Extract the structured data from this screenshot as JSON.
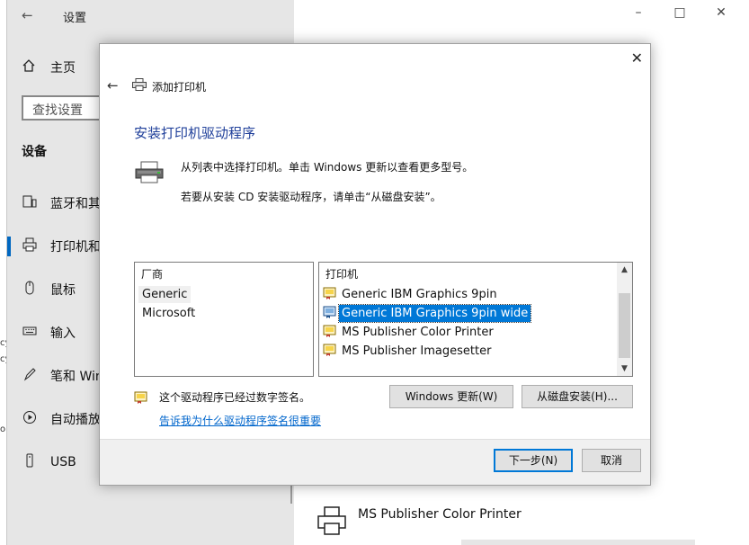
{
  "settings": {
    "title": "设置",
    "home_label": "主页",
    "search_placeholder": "查找设置",
    "section_title": "设备",
    "nav_items": [
      {
        "label": "蓝牙和其"
      },
      {
        "label": "打印机和"
      },
      {
        "label": "鼠标"
      },
      {
        "label": "输入"
      },
      {
        "label": "笔和 Win"
      },
      {
        "label": "自动播放"
      },
      {
        "label": "USB"
      }
    ],
    "strip_fragments": [
      "cy",
      "cy",
      "ol"
    ],
    "bg_printer_label": "MS Publisher Color Printer"
  },
  "dialog": {
    "title": "添加打印机",
    "heading": "安装打印机驱动程序",
    "message1": "从列表中选择打印机。单击 Windows 更新以查看更多型号。",
    "message2": "若要从安装 CD 安装驱动程序，请单击“从磁盘安装”。",
    "manufacturer_header": "厂商",
    "manufacturers": [
      "Generic",
      "Microsoft"
    ],
    "selected_manufacturer": "Generic",
    "printer_header": "打印机",
    "printers": [
      "Generic IBM Graphics 9pin",
      "Generic IBM Graphics 9pin wide",
      "MS Publisher Color Printer",
      "MS Publisher Imagesetter"
    ],
    "selected_printer": "Generic IBM Graphics 9pin wide",
    "signed_text": "这个驱动程序已经过数字签名。",
    "signed_link": "告诉我为什么驱动程序签名很重要",
    "windows_update_button": "Windows 更新(W)",
    "have_disk_button": "从磁盘安装(H)...",
    "next_button": "下一步(N)",
    "cancel_button": "取消"
  },
  "colors": {
    "accent": "#0078d7",
    "heading": "#1f3f9a",
    "link": "#0066cc"
  }
}
